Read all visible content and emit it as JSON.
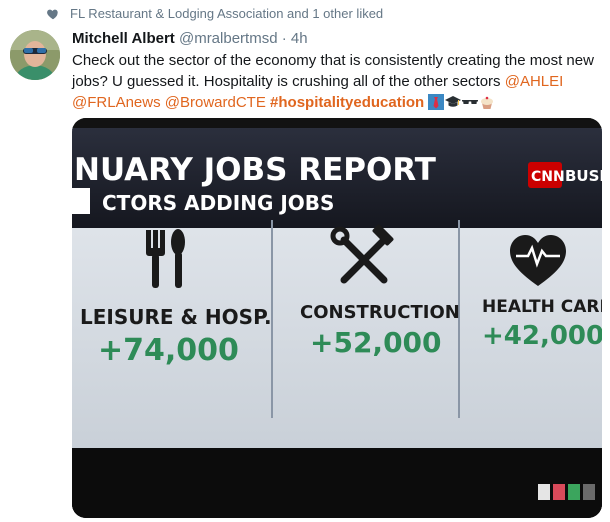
{
  "social_context": {
    "text": "FL Restaurant & Lodging Association and 1 other liked",
    "icon": "heart-icon"
  },
  "tweet": {
    "author_name": "Mitchell Albert",
    "author_handle": "@mralbertmsd",
    "separator": "·",
    "time": "4h",
    "text_line1": "Check out the sector of the economy that is consistently creating the most new",
    "text_line2_plain": "jobs? U guessed it. Hospitality is crushing all of the other sectors ",
    "mention_ahlei": "@AHLEI",
    "mention_frlanews": "@FRLAnews",
    "mention_browardcte": "@BrowardCTE",
    "hashtag": "#hospitalityeducation",
    "emojis": [
      "necktie",
      "graduation-cap",
      "sunglasses",
      "cupcake"
    ]
  },
  "media": {
    "report_title": "NUARY JOBS REPORT",
    "subtitle_prefix": "CTORS ADDING JOBS",
    "network": "CNN",
    "network_suffix": "BUSINE",
    "sectors": [
      {
        "label": "LEISURE & HOSP.",
        "value": "+74,000",
        "icon": "fork-spoon-icon"
      },
      {
        "label": "CONSTRUCTION",
        "value": "+52,000",
        "icon": "hammer-wrench-icon"
      },
      {
        "label": "HEALTH CARE",
        "value": "+42,000",
        "icon": "heartbeat-icon"
      }
    ],
    "colors": {
      "screen_bg": "#dfe4ea",
      "banner": "#1c1f2a",
      "value_green": "#2e8b57",
      "cnn_red": "#cc0000"
    }
  }
}
